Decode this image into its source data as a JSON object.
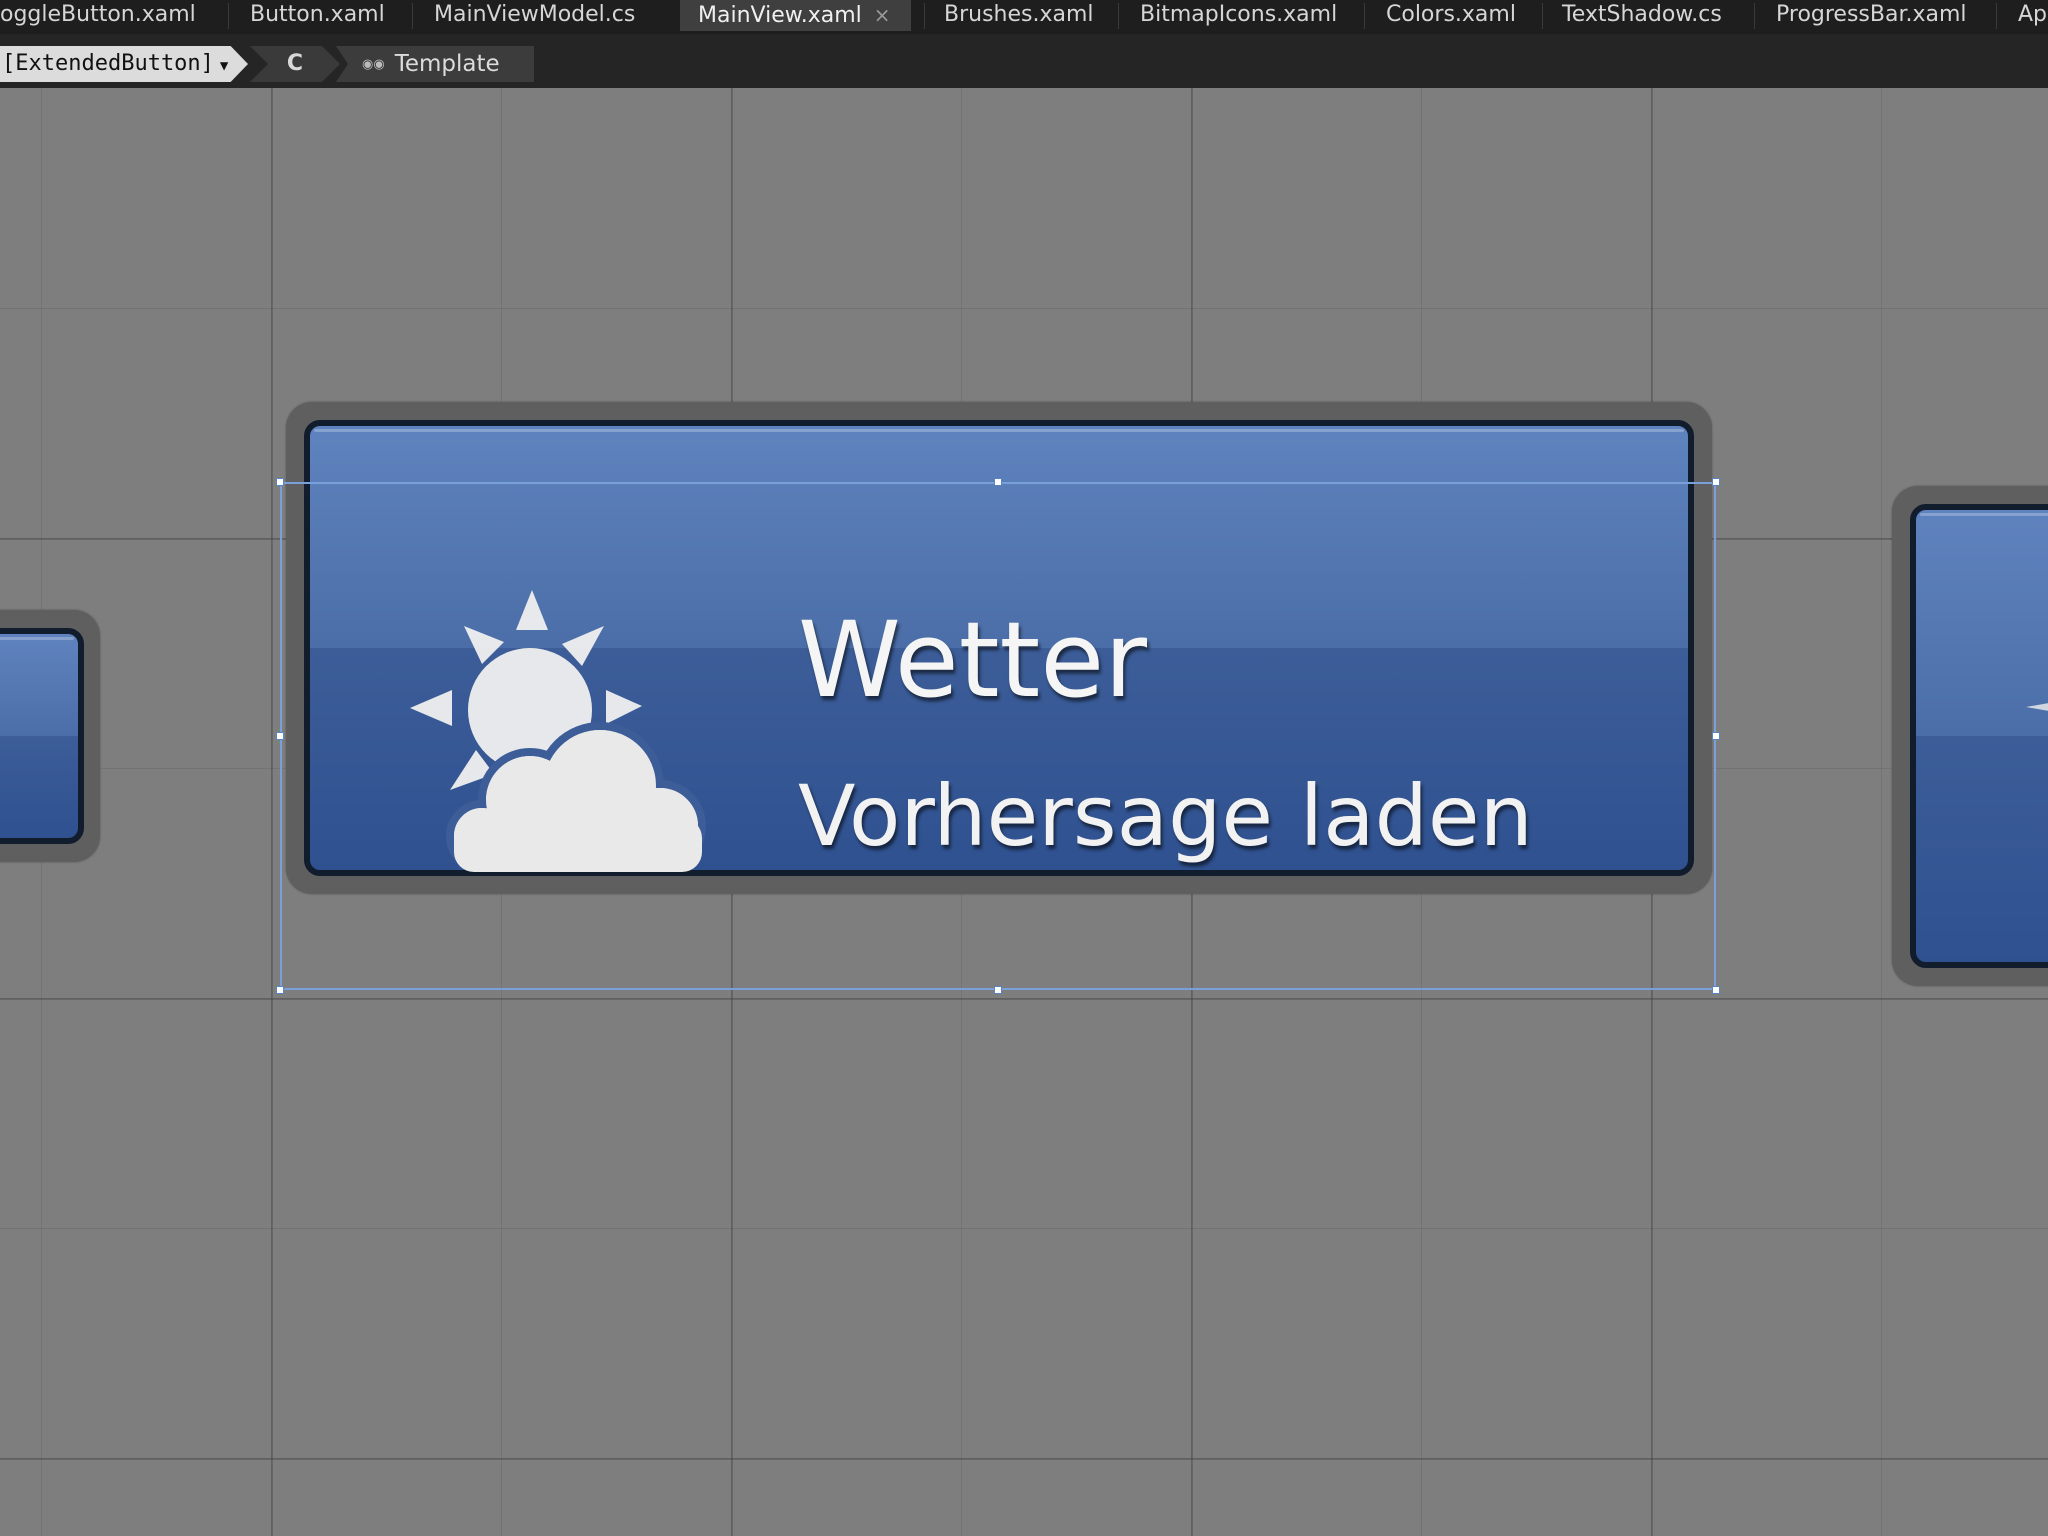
{
  "tabs": [
    {
      "label": "oggleButton.xaml",
      "active": false
    },
    {
      "label": "Button.xaml",
      "active": false
    },
    {
      "label": "MainViewModel.cs",
      "active": false
    },
    {
      "label": "MainView.xaml",
      "active": true,
      "close": "×"
    },
    {
      "label": "Brushes.xaml",
      "active": false
    },
    {
      "label": "BitmapIcons.xaml",
      "active": false
    },
    {
      "label": "Colors.xaml",
      "active": false
    },
    {
      "label": "TextShadow.cs",
      "active": false
    },
    {
      "label": "ProgressBar.xaml",
      "active": false
    },
    {
      "label": "Ap",
      "active": false
    }
  ],
  "breadcrumb": {
    "scope": "[ExtendedButton]",
    "ref_glyph": "C",
    "template": "Template"
  },
  "button": {
    "title": "Wetter",
    "subtitle": "Vorhersage laden",
    "icon": "sun-cloud-icon"
  },
  "colors": {
    "tab_bar": "#1e1e1e",
    "canvas": "#7e7e7e",
    "button_top": "#5f83be",
    "button_bottom": "#2f5190",
    "selection": "#7aa0dc"
  }
}
